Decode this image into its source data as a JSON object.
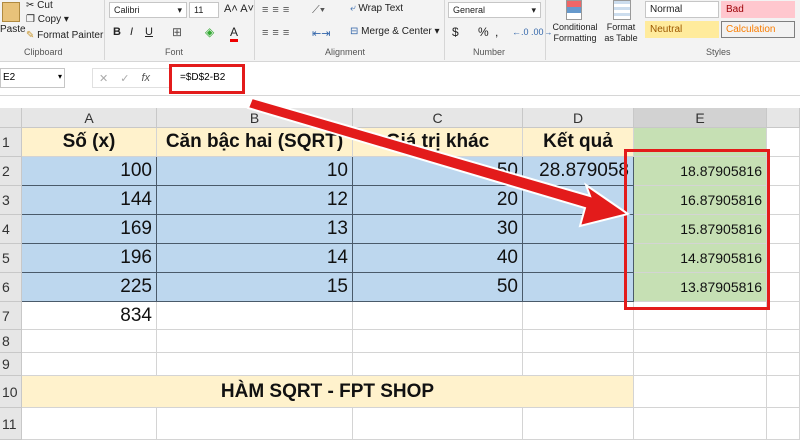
{
  "ribbon": {
    "clipboard": {
      "paste": "Paste",
      "cut": "Cut",
      "copy": "Copy",
      "format_painter": "Format Painter",
      "label": "Clipboard"
    },
    "font": {
      "name": "Calibri",
      "size": "11",
      "label": "Font",
      "bold": "B",
      "italic": "I",
      "underline": "U"
    },
    "alignment": {
      "wrap": "Wrap Text",
      "merge": "Merge & Center",
      "label": "Alignment"
    },
    "number": {
      "format": "General",
      "currency": "$",
      "percent": "%",
      "comma": ",",
      "label": "Number"
    },
    "styles": {
      "conditional": "Conditional Formatting",
      "format_table": "Format as Table",
      "normal": "Normal",
      "bad": "Bad",
      "neutral": "Neutral",
      "calculation": "Calculation",
      "label": "Styles"
    }
  },
  "formula_bar": {
    "name_box": "E2",
    "fx": "fx",
    "formula": "=$D$2-B2",
    "cancel": "✕",
    "enter": "✓"
  },
  "columns": [
    "A",
    "B",
    "C",
    "D",
    "E"
  ],
  "rows": [
    "1",
    "2",
    "3",
    "4",
    "5",
    "6",
    "7",
    "8",
    "9",
    "10",
    "11"
  ],
  "headers": [
    "Số (x)",
    "Căn bậc hai (SQRT)",
    "Giá trị khác",
    "Kết quả",
    ""
  ],
  "data": [
    [
      "100",
      "10",
      "50",
      "28.879058",
      "18.87905816"
    ],
    [
      "144",
      "12",
      "20",
      "",
      "16.87905816"
    ],
    [
      "169",
      "13",
      "30",
      "",
      "15.87905816"
    ],
    [
      "196",
      "14",
      "40",
      "",
      "14.87905816"
    ],
    [
      "225",
      "15",
      "50",
      "",
      "13.87905816"
    ]
  ],
  "total": "834",
  "title": "HÀM SQRT - FPT SHOP",
  "colors": {
    "highlight": "#e31b1b",
    "blue_fill": "#bdd7ee",
    "green_fill": "#c6e0b4",
    "header_fill": "#fff2cc"
  }
}
